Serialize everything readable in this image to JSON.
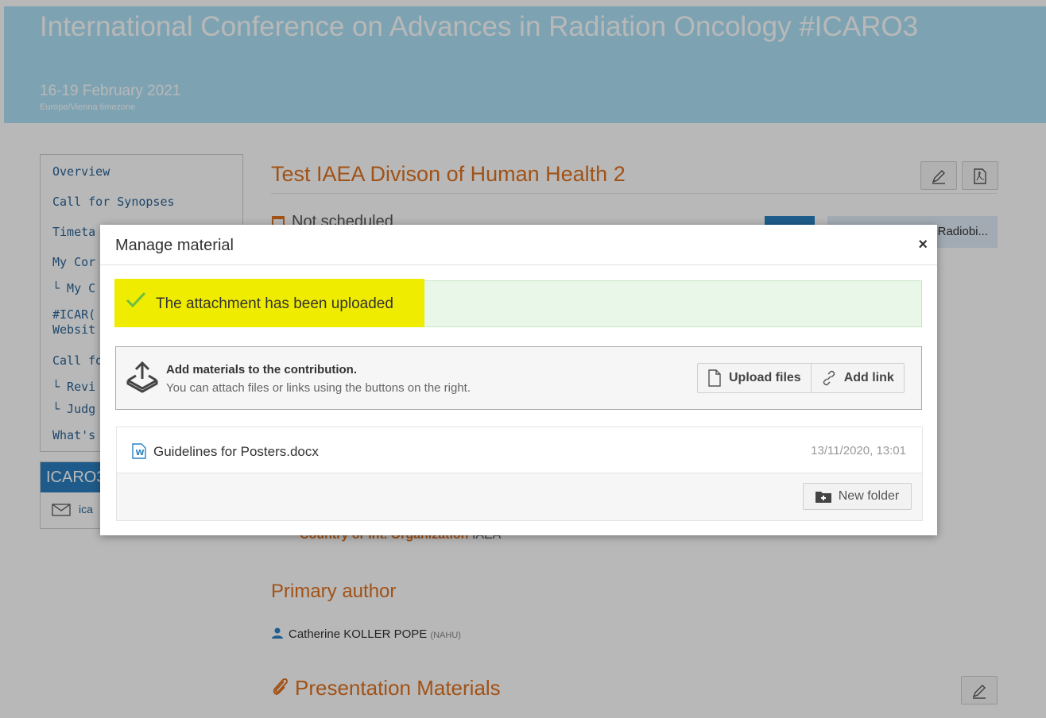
{
  "banner": {
    "title": "International Conference on Advances in Radiation Oncology #ICARO3",
    "dates": "16-19 February 2021",
    "timezone": "Europe/Vienna timezone"
  },
  "sidebar": {
    "items": [
      {
        "label": "Overview"
      },
      {
        "label": "Call for Synopses"
      },
      {
        "label": "Timeta"
      },
      {
        "label": "My Cor"
      },
      {
        "label": "└ My C"
      },
      {
        "label": "#ICAR("
      },
      {
        "label": "Websit"
      },
      {
        "label": "Call for"
      },
      {
        "label": "└ Revi"
      },
      {
        "label": "└ Judg"
      },
      {
        "label": "What's"
      }
    ],
    "conference_box": {
      "title": "ICARO3",
      "email": "ica"
    }
  },
  "contribution": {
    "title": "Test IAEA Divison of Human Health 2",
    "schedule": "Not scheduled",
    "track_button": "Radiobi...",
    "country_label": "Country or Int. Organization",
    "country_value": "IAEA",
    "primary_author_heading": "Primary author",
    "author_name": "Catherine KOLLER POPE",
    "author_affiliation": "(NAHU)",
    "materials_heading": "Presentation Materials"
  },
  "modal": {
    "title": "Manage material",
    "close": "×",
    "success_message": "The attachment has been uploaded",
    "add_title": "Add materials to the contribution.",
    "add_subtitle": "You can attach files or links using the buttons on the right.",
    "upload_label": "Upload files",
    "add_link_label": "Add link",
    "file": {
      "name": "Guidelines for Posters.docx",
      "date": "13/11/2020, 13:01"
    },
    "new_folder_label": "New folder"
  },
  "colors": {
    "accent": "#e0721f",
    "banner": "#aee2f9",
    "success_bg": "#e8f7e8",
    "highlight": "#f0ec00"
  }
}
